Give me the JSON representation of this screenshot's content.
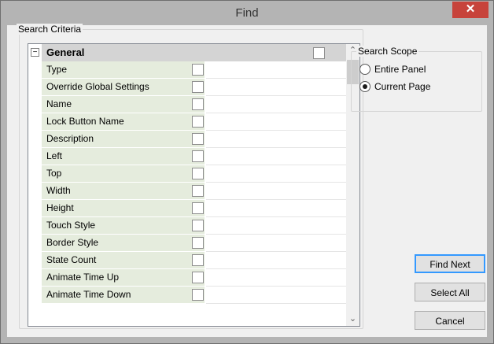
{
  "window": {
    "title": "Find",
    "close_icon": "close-icon"
  },
  "search_criteria": {
    "label": "Search Criteria",
    "category": {
      "label": "General",
      "expander_icon": "minus-box-icon",
      "expanded": true,
      "checked": false
    },
    "properties": [
      {
        "name": "Type",
        "checked": false,
        "value": ""
      },
      {
        "name": "Override Global Settings",
        "checked": false,
        "value": ""
      },
      {
        "name": "Name",
        "checked": false,
        "value": ""
      },
      {
        "name": "Lock Button Name",
        "checked": false,
        "value": ""
      },
      {
        "name": "Description",
        "checked": false,
        "value": ""
      },
      {
        "name": "Left",
        "checked": false,
        "value": ""
      },
      {
        "name": "Top",
        "checked": false,
        "value": ""
      },
      {
        "name": "Width",
        "checked": false,
        "value": ""
      },
      {
        "name": "Height",
        "checked": false,
        "value": ""
      },
      {
        "name": "Touch Style",
        "checked": false,
        "value": ""
      },
      {
        "name": "Border Style",
        "checked": false,
        "value": ""
      },
      {
        "name": "State Count",
        "checked": false,
        "value": ""
      },
      {
        "name": "Animate Time Up",
        "checked": false,
        "value": ""
      },
      {
        "name": "Animate Time Down",
        "checked": false,
        "value": ""
      }
    ],
    "scrollbar": {
      "up_icon": "chevron-up-icon",
      "down_icon": "chevron-down-icon"
    }
  },
  "search_scope": {
    "label": "Search Scope",
    "options": [
      {
        "label": "Entire Panel",
        "selected": false
      },
      {
        "label": "Current Page",
        "selected": true
      }
    ]
  },
  "buttons": {
    "find_next": "Find Next",
    "select_all": "Select All",
    "cancel": "Cancel"
  },
  "colors": {
    "title_bar": "#b4b4b4",
    "close_button": "#c7433b",
    "category_row": "#d4d4d4",
    "property_name_cell": "#e5ecdd",
    "dialog_background": "#f0f0f0",
    "default_button_border": "#3399ff"
  }
}
